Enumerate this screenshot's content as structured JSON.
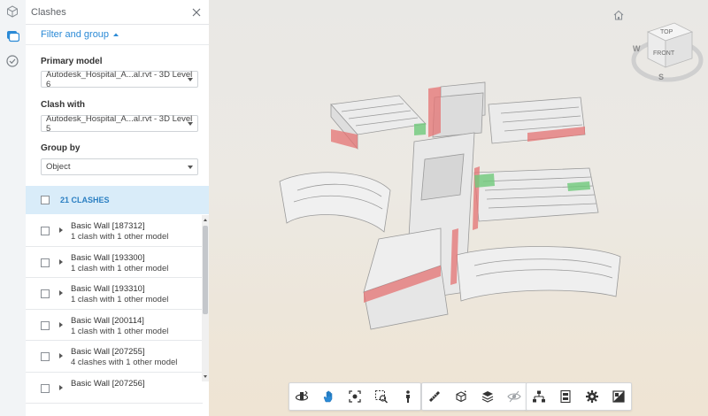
{
  "panel": {
    "title": "Clashes",
    "filter_toggle_label": "Filter and group",
    "primary_model": {
      "label": "Primary model",
      "value": "Autodesk_Hospital_A...al.rvt - 3D Level 6"
    },
    "clash_with": {
      "label": "Clash with",
      "value": "Autodesk_Hospital_A...al.rvt - 3D Level 5"
    },
    "group_by": {
      "label": "Group by",
      "value": "Object"
    },
    "clash_count_label": "21 CLASHES",
    "items": [
      {
        "name": "Basic Wall [187312]",
        "desc": "1 clash with 1 other model"
      },
      {
        "name": "Basic Wall [193300]",
        "desc": "1 clash with 1 other model"
      },
      {
        "name": "Basic Wall [193310]",
        "desc": "1 clash with 1 other model"
      },
      {
        "name": "Basic Wall [200114]",
        "desc": "1 clash with 1 other model"
      },
      {
        "name": "Basic Wall [207255]",
        "desc": "4 clashes with 1 other model"
      },
      {
        "name": "Basic Wall [207256]",
        "desc": ""
      }
    ]
  },
  "viewcube": {
    "top": "TOP",
    "front": "FRONT",
    "west": "W",
    "south": "S"
  },
  "icons": [
    "cube-icon",
    "clashes-icon",
    "check-circle-icon",
    "close-icon",
    "home-icon",
    "orbit-icon",
    "pan-icon",
    "fit-view-icon",
    "zoom-window-icon",
    "first-person-icon",
    "measure-icon",
    "section-icon",
    "layers-icon",
    "explode-icon",
    "model-browser-icon",
    "properties-icon",
    "settings-icon",
    "fullscreen-icon"
  ],
  "colors": {
    "accent": "#2b8ad6",
    "clash_header_bg": "#d9ecf9",
    "clash_red": "#e57373",
    "clash_green": "#6fc97a"
  }
}
